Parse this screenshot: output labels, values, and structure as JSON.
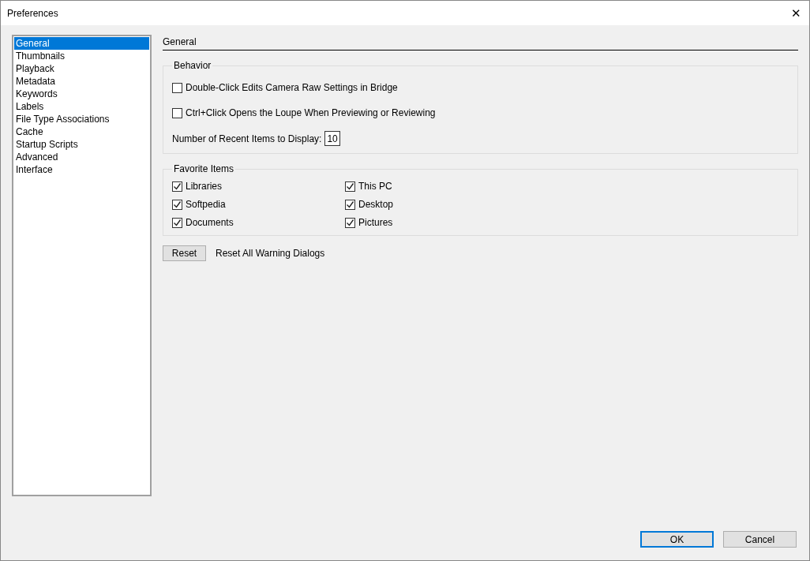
{
  "window": {
    "title": "Preferences",
    "close": "✕"
  },
  "sidebar": {
    "items": [
      {
        "label": "General",
        "selected": true
      },
      {
        "label": "Thumbnails",
        "selected": false
      },
      {
        "label": "Playback",
        "selected": false
      },
      {
        "label": "Metadata",
        "selected": false
      },
      {
        "label": "Keywords",
        "selected": false
      },
      {
        "label": "Labels",
        "selected": false
      },
      {
        "label": "File Type Associations",
        "selected": false
      },
      {
        "label": "Cache",
        "selected": false
      },
      {
        "label": "Startup Scripts",
        "selected": false
      },
      {
        "label": "Advanced",
        "selected": false
      },
      {
        "label": "Interface",
        "selected": false
      }
    ]
  },
  "panel": {
    "heading": "General",
    "behavior": {
      "title": "Behavior",
      "options": [
        {
          "label": "Double-Click Edits Camera Raw Settings in Bridge",
          "checked": false
        },
        {
          "label": "Ctrl+Click Opens the Loupe When Previewing or Reviewing",
          "checked": false
        }
      ],
      "recent_items": {
        "label": "Number of Recent Items to Display:",
        "value": "10"
      }
    },
    "favorite_items": {
      "title": "Favorite Items",
      "items": [
        {
          "label": "Libraries",
          "checked": true
        },
        {
          "label": "This PC",
          "checked": true
        },
        {
          "label": "Softpedia",
          "checked": true
        },
        {
          "label": "Desktop",
          "checked": true
        },
        {
          "label": "Documents",
          "checked": true
        },
        {
          "label": "Pictures",
          "checked": true
        }
      ]
    },
    "reset": {
      "button": "Reset",
      "label": "Reset All Warning Dialogs"
    }
  },
  "buttons": [
    {
      "label": "OK",
      "selected": true
    },
    {
      "label": "Cancel",
      "selected": false
    }
  ]
}
